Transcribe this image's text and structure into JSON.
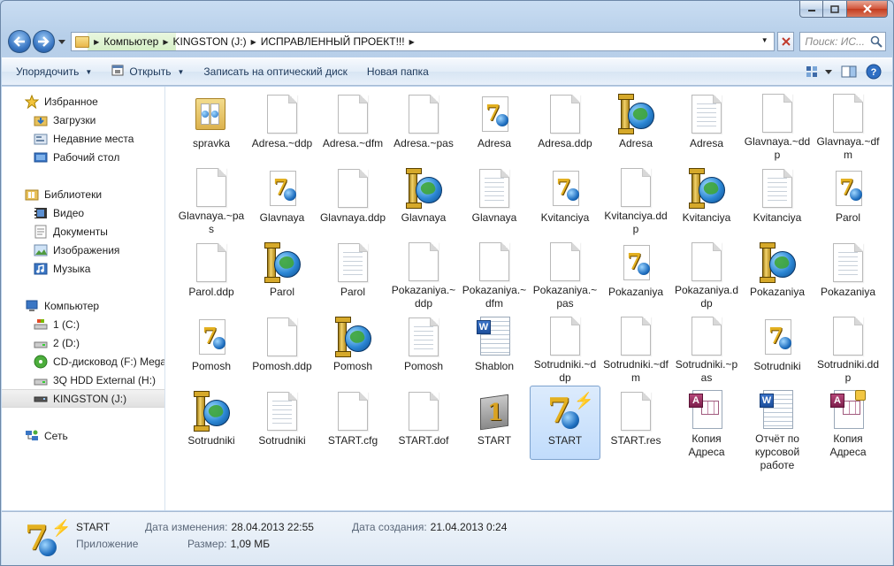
{
  "window": {
    "caption_buttons": [
      "minimize",
      "maximize",
      "close"
    ]
  },
  "address": {
    "crumbs": [
      "Компьютер",
      "KINGSTON (J:)",
      "ИСПРАВЛЕННЫЙ ПРОЕКТ!!!"
    ],
    "search_placeholder": "Поиск: ИС..."
  },
  "toolbar": {
    "organize": "Упорядочить",
    "open": "Открыть",
    "burn": "Записать на оптический диск",
    "new_folder": "Новая папка"
  },
  "sidebar": {
    "favorites": {
      "label": "Избранное",
      "items": [
        "Загрузки",
        "Недавние места",
        "Рабочий стол"
      ]
    },
    "libraries": {
      "label": "Библиотеки",
      "items": [
        "Видео",
        "Документы",
        "Изображения",
        "Музыка"
      ]
    },
    "computer": {
      "label": "Компьютер",
      "items": [
        "1 (C:)",
        "2 (D:)",
        "CD-дисковод (F:) Mega",
        "3Q HDD External (H:)",
        "KINGSTON (J:)"
      ],
      "selected": "KINGSTON (J:)"
    },
    "network": {
      "label": "Сеть"
    }
  },
  "files": [
    {
      "name": "spravka",
      "icon": "folder-icon"
    },
    {
      "name": "Adresa.~ddp",
      "icon": "blank-file-icon"
    },
    {
      "name": "Adresa.~dfm",
      "icon": "blank-file-icon"
    },
    {
      "name": "Adresa.~pas",
      "icon": "blank-file-icon"
    },
    {
      "name": "Adresa",
      "icon": "delphi-unit-icon"
    },
    {
      "name": "Adresa.ddp",
      "icon": "blank-file-icon"
    },
    {
      "name": "Adresa",
      "icon": "delphi-form-icon"
    },
    {
      "name": "Adresa",
      "icon": "text-file-icon"
    },
    {
      "name": "Glavnaya.~ddp",
      "icon": "blank-file-icon"
    },
    {
      "name": "Glavnaya.~dfm",
      "icon": "blank-file-icon"
    },
    {
      "name": "Glavnaya.~pas",
      "icon": "blank-file-icon"
    },
    {
      "name": "Glavnaya",
      "icon": "delphi-unit-icon"
    },
    {
      "name": "Glavnaya.ddp",
      "icon": "blank-file-icon"
    },
    {
      "name": "Glavnaya",
      "icon": "delphi-form-icon"
    },
    {
      "name": "Glavnaya",
      "icon": "text-file-icon"
    },
    {
      "name": "Kvitanciya",
      "icon": "delphi-unit-icon"
    },
    {
      "name": "Kvitanciya.ddp",
      "icon": "blank-file-icon"
    },
    {
      "name": "Kvitanciya",
      "icon": "delphi-form-icon"
    },
    {
      "name": "Kvitanciya",
      "icon": "text-file-icon"
    },
    {
      "name": "Parol",
      "icon": "delphi-unit-icon"
    },
    {
      "name": "Parol.ddp",
      "icon": "blank-file-icon"
    },
    {
      "name": "Parol",
      "icon": "delphi-form-icon"
    },
    {
      "name": "Parol",
      "icon": "text-file-icon"
    },
    {
      "name": "Pokazaniya.~ddp",
      "icon": "blank-file-icon"
    },
    {
      "name": "Pokazaniya.~dfm",
      "icon": "blank-file-icon"
    },
    {
      "name": "Pokazaniya.~pas",
      "icon": "blank-file-icon"
    },
    {
      "name": "Pokazaniya",
      "icon": "delphi-unit-icon"
    },
    {
      "name": "Pokazaniya.ddp",
      "icon": "blank-file-icon"
    },
    {
      "name": "Pokazaniya",
      "icon": "delphi-form-icon"
    },
    {
      "name": "Pokazaniya",
      "icon": "text-file-icon"
    },
    {
      "name": "Pomosh",
      "icon": "delphi-unit-icon"
    },
    {
      "name": "Pomosh.ddp",
      "icon": "blank-file-icon"
    },
    {
      "name": "Pomosh",
      "icon": "delphi-form-icon"
    },
    {
      "name": "Pomosh",
      "icon": "text-file-icon"
    },
    {
      "name": "Shablon",
      "icon": "word-doc-icon"
    },
    {
      "name": "Sotrudniki.~ddp",
      "icon": "blank-file-icon"
    },
    {
      "name": "Sotrudniki.~dfm",
      "icon": "blank-file-icon"
    },
    {
      "name": "Sotrudniki.~pas",
      "icon": "blank-file-icon"
    },
    {
      "name": "Sotrudniki",
      "icon": "delphi-unit-icon"
    },
    {
      "name": "Sotrudniki.ddp",
      "icon": "blank-file-icon"
    },
    {
      "name": "Sotrudniki",
      "icon": "delphi-form-icon"
    },
    {
      "name": "Sotrudniki",
      "icon": "text-file-icon"
    },
    {
      "name": "START.cfg",
      "icon": "blank-file-icon"
    },
    {
      "name": "START.dof",
      "icon": "blank-file-icon"
    },
    {
      "name": "START",
      "icon": "delphi-project-icon"
    },
    {
      "name": "START",
      "icon": "delphi-exe-icon",
      "selected": true
    },
    {
      "name": "START.res",
      "icon": "blank-file-icon"
    },
    {
      "name": "Копия Адреса",
      "icon": "access-doc-icon"
    },
    {
      "name": "Отчёт по курсовой работе",
      "icon": "word-doc-icon"
    },
    {
      "name": "Копия Адреса",
      "icon": "access-locked-icon"
    }
  ],
  "details": {
    "name": "START",
    "type": "Приложение",
    "modified_label": "Дата изменения:",
    "modified_value": "28.04.2013 22:55",
    "created_label": "Дата создания:",
    "created_value": "21.04.2013 0:24",
    "size_label": "Размер:",
    "size_value": "1,09 МБ"
  }
}
